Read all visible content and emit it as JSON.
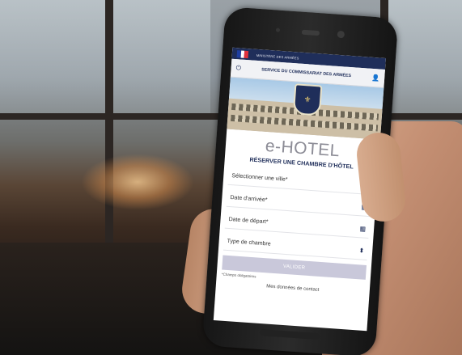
{
  "app": {
    "ministry_label": "MINISTÈRE DES ARMÉES",
    "service_title": "SERVICE DU COMMISSARIAT DES ARMÉES",
    "app_name": "e-HOTEL",
    "subtitle": "RÉSERVER UNE CHAMBRE D'HÔTEL",
    "fields": [
      {
        "label": "Sélectionner une ville*",
        "icon": "thumbs-up-icon"
      },
      {
        "label": "Date d'arrivée*",
        "icon": "calendar-icon"
      },
      {
        "label": "Date de départ*",
        "icon": "calendar-icon"
      },
      {
        "label": "Type de chambre",
        "icon": "sort-arrows-icon"
      }
    ],
    "submit_label": "VALIDER",
    "required_note": "*Champs obligatoires",
    "footer_link": "Mes données de contact"
  },
  "colors": {
    "navy": "#1f2e5a",
    "button_disabled": "#c9c8da",
    "flag_blue": "#1f3ea0",
    "flag_white": "#ffffff",
    "flag_red": "#e0323c"
  }
}
